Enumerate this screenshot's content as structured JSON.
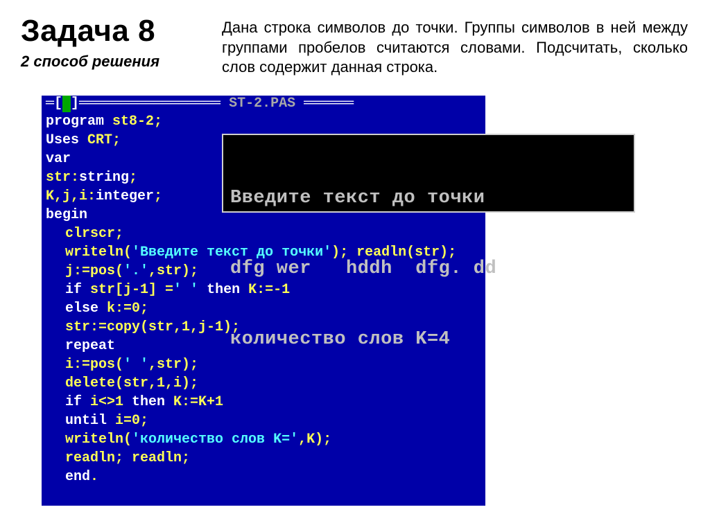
{
  "header": {
    "title": "Задача 8",
    "subtitle": "2 способ решения",
    "description": "Дана строка символов до точки. Группы символов в ней между группами пробелов считаются словами. Подсчитать, сколько слов содержит данная строка."
  },
  "ide": {
    "filename": "ST-2.PAS",
    "code": {
      "l1_kw": "program ",
      "l1_id": "st8-2",
      "l1_sc": ";",
      "l2_kw": "Uses ",
      "l2_id": "CRT",
      "l2_sc": ";",
      "l3_kw": "var",
      "l4_id": "str",
      "l4_col": ":",
      "l4_kw": "string",
      "l4_sc": ";",
      "l5_id": "K,j,i",
      "l5_col": ":",
      "l5_kw": "integer",
      "l5_sc": ";",
      "l6_kw": "begin",
      "l7_id": "clrscr",
      "l7_sc": ";",
      "l8_id": "writeln",
      "l8_p1": "(",
      "l8_str": "'Введите текст до точки'",
      "l8_p2": ");",
      "l8_id2": " readln",
      "l8_p3": "(str);",
      "l9_id": "j",
      "l9_rest": ":=pos(",
      "l9_str": "'.'",
      "l9_rest2": ",str);",
      "l10_kw": "if ",
      "l10_id": "str[j-1] =",
      "l10_str": "' '",
      "l10_kw2": " then ",
      "l10_id2": "K:=-1",
      "l11_kw": "else ",
      "l11_id": "k:=0",
      "l11_sc": ";",
      "l12_id": "str",
      "l12_rest": ":=copy(str,1,j-1);",
      "l13_kw": "repeat",
      "l14_id": "i",
      "l14_rest": ":=pos(",
      "l14_str": "' '",
      "l14_rest2": ",str);",
      "l15_id": "delete",
      "l15_rest": "(str,1,i);",
      "l16_kw": "if ",
      "l16_id": "i<>1",
      "l16_kw2": " then ",
      "l16_id2": "K:=K+1",
      "l17_kw": "until ",
      "l17_id": "i=0",
      "l17_sc": ";",
      "l18_id": "writeln",
      "l18_p1": "(",
      "l18_str": "'количество слов K='",
      "l18_p2": ",K);",
      "l19_id": "readln",
      "l19_sc": ";",
      "l19_id2": " readln",
      "l19_sc2": ";",
      "l20_kw": "end",
      "l20_sc": "."
    }
  },
  "console": {
    "line1": "Введите текст до точки",
    "line2": "dfg wer   hddh  dfg. dd",
    "line3": "количество слов K=4"
  }
}
